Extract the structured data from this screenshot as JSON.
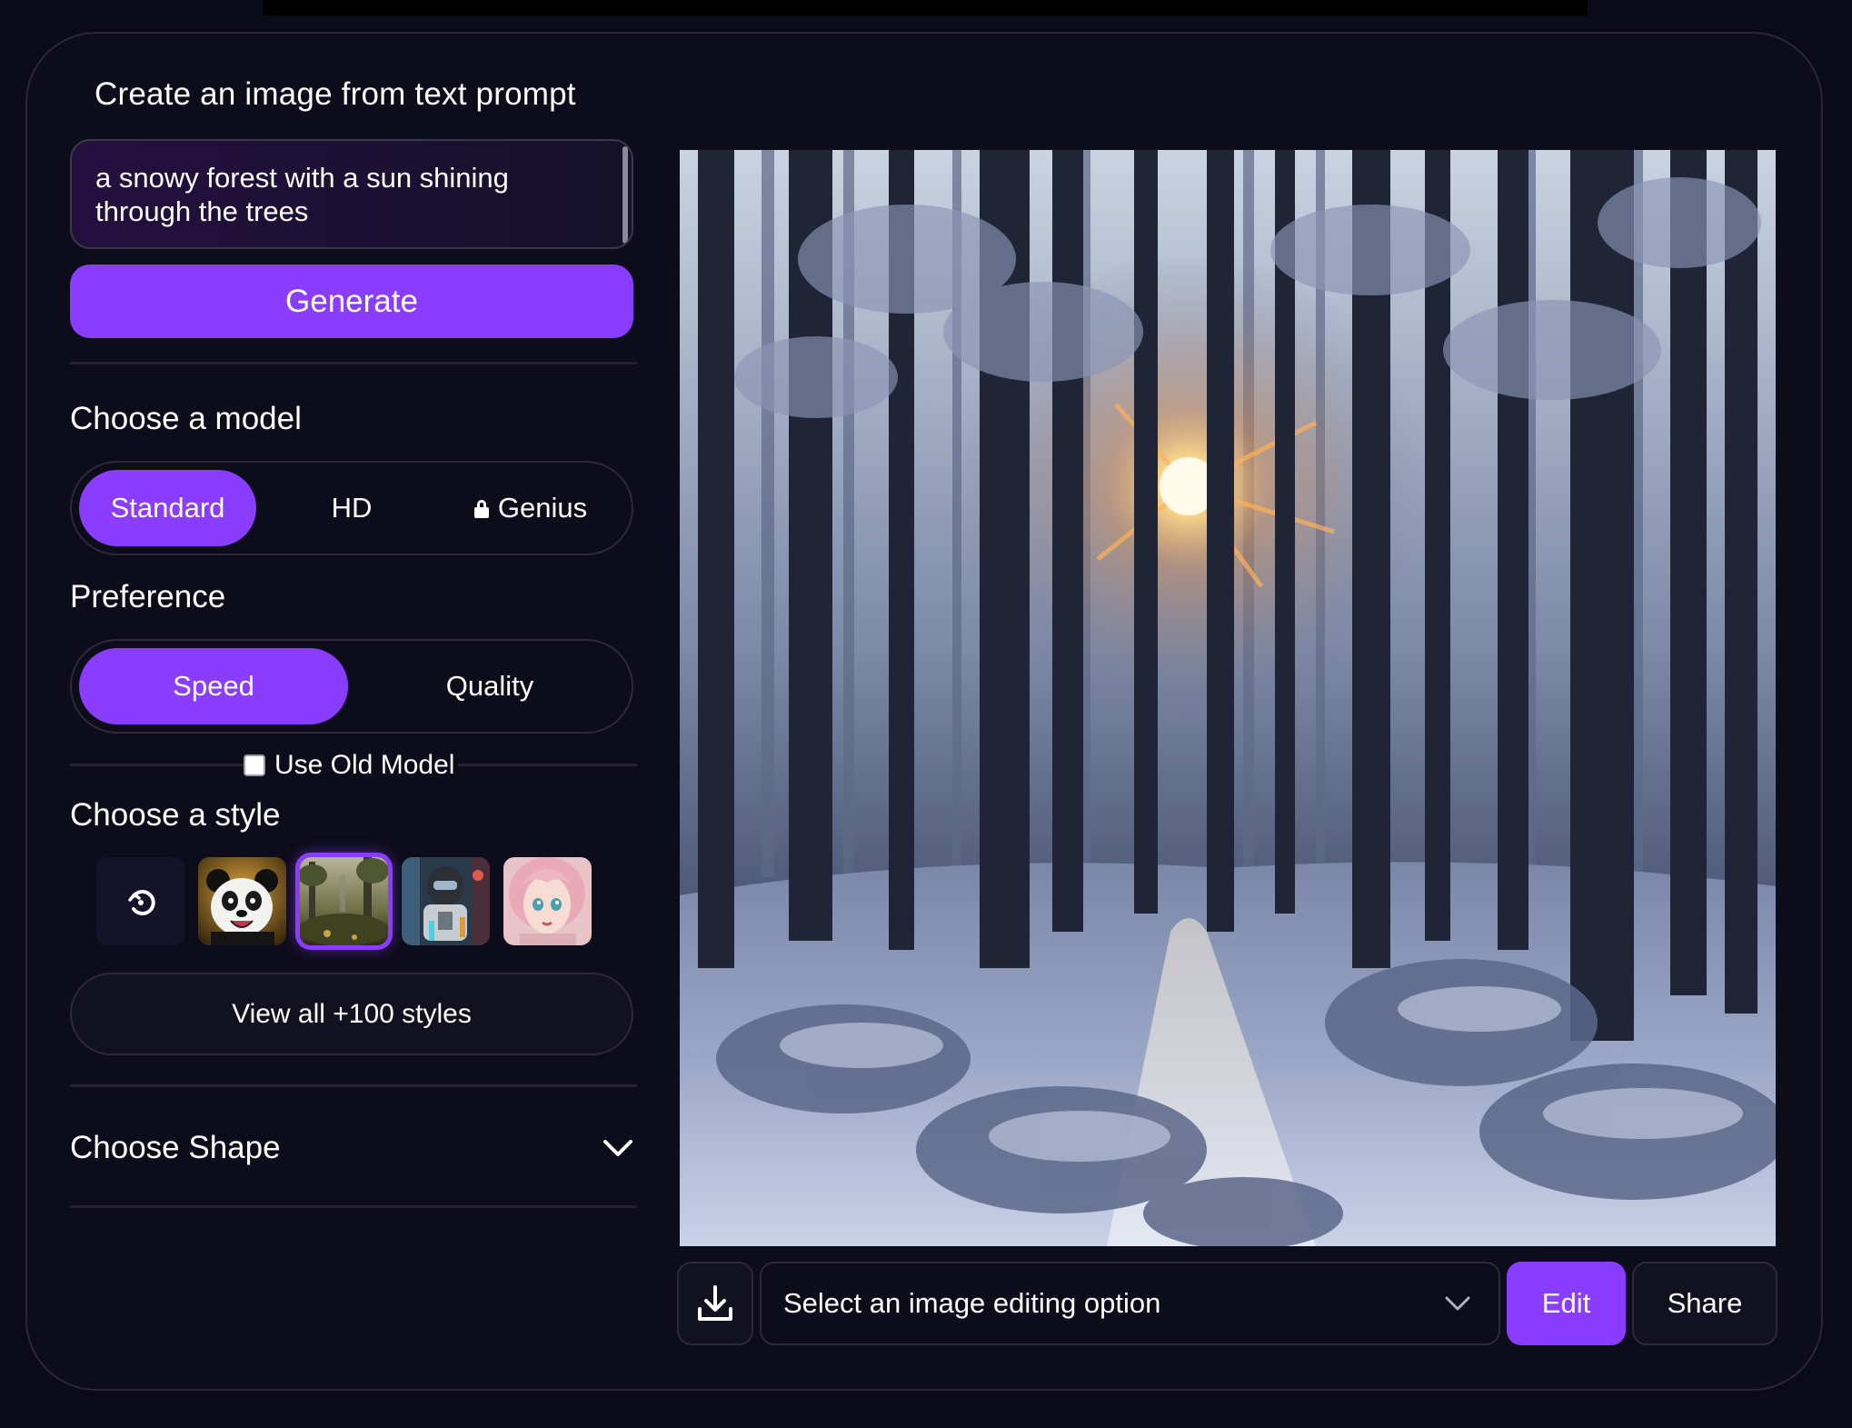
{
  "header": {
    "title": "Create an image from text prompt"
  },
  "prompt": {
    "value": "a snowy forest with a sun shining through the trees"
  },
  "generate": {
    "label": "Generate"
  },
  "model": {
    "label": "Choose a model",
    "options": [
      "Standard",
      "HD",
      "Genius"
    ],
    "selected": "Standard",
    "locked": [
      "Genius"
    ]
  },
  "preference": {
    "label": "Preference",
    "options": [
      "Speed",
      "Quality"
    ],
    "selected": "Speed"
  },
  "old_model": {
    "label": "Use Old Model",
    "checked": false
  },
  "style": {
    "label": "Choose a style",
    "thumbs": [
      "none",
      "panda",
      "forest-landscape",
      "robot",
      "anime-girl"
    ],
    "selected": "forest-landscape",
    "view_all_label": "View all +100 styles"
  },
  "shape": {
    "label": "Choose Shape"
  },
  "editor": {
    "select_placeholder": "Select an image editing option",
    "edit_label": "Edit",
    "share_label": "Share"
  },
  "colors": {
    "accent": "#8b3dff",
    "background": "#0b0a19",
    "card": "#0d0c1b"
  },
  "icons": [
    "download-icon",
    "chevron-down-icon",
    "lock-icon",
    "no-style-icon"
  ]
}
